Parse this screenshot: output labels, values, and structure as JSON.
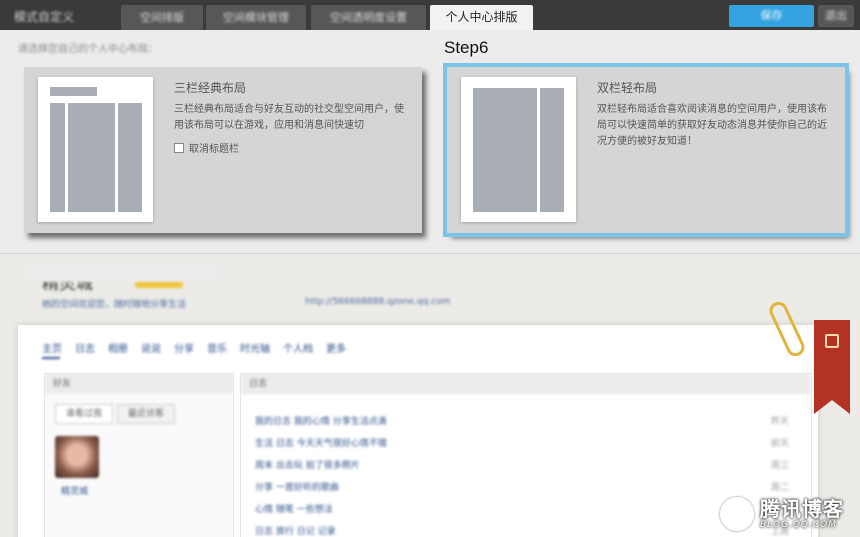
{
  "topbar": {
    "title": "模式自定义",
    "tabs": [
      "空间排版",
      "空间模块管理",
      "空间透明度设置",
      "个人中心排版"
    ],
    "active_tab": "个人中心排版",
    "save_label": "保存",
    "exit_label": "退出"
  },
  "panel": {
    "hint": "请选择您自己的个人中心布局：",
    "step_label": "Step6",
    "layouts": [
      {
        "title": "三栏经典布局",
        "desc": "三栏经典布局适合与好友互动的社交型空间用户，使用该布局可以在游戏，应用和消息间快速切",
        "checkbox_label": "取消标题栏",
        "selected": false
      },
      {
        "title": "双栏轻布局",
        "desc": "双栏轻布局适合喜欢阅读消息的空间用户，使用该布局可以快速简单的获取好友动态消息并使你自己的近况方便的被好友知道！",
        "selected": true
      }
    ]
  },
  "preview": {
    "site_name": "精灵城",
    "site_sub": "她的空间欢迎您，随时随地分享生活",
    "site_url": "http://566668888.qzone.qq.com",
    "nav": [
      "主页",
      "日志",
      "相册",
      "说说",
      "分享",
      "音乐",
      "时光轴",
      "个人档",
      "更多"
    ],
    "left_header": "好友",
    "left_tabs": [
      "谁看过我",
      "最近访客"
    ],
    "avatar_name": "精灵城",
    "right_header": "日志",
    "rows": [
      {
        "title": "我的日志 我的心情 分享生活点滴",
        "date": "昨天"
      },
      {
        "title": "生活 日志 今天天气很好心情不错",
        "date": "前天"
      },
      {
        "title": "周末 出去玩 拍了很多照片",
        "date": "周三"
      },
      {
        "title": "分享 一首好听的歌曲",
        "date": "周二"
      },
      {
        "title": "心情 随笔 一些想法",
        "date": "周一"
      },
      {
        "title": "日志 旅行 日记 记录",
        "date": "上周"
      }
    ]
  },
  "watermark": {
    "cn": "腾讯博客",
    "en": "BLOG.QQ.COM"
  },
  "colors": {
    "accent": "#33a2df",
    "selected_outline": "#7cc3ea",
    "ribbon": "#b33224"
  }
}
